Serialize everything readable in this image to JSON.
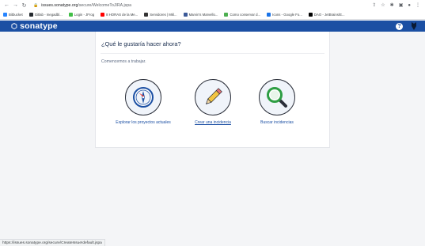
{
  "browser": {
    "url_host": "issues.sonatype.org",
    "url_path": "/secure/WelcomeToJIRA.jspa",
    "bookmarks": [
      {
        "label": "Bitbucket",
        "color": "#2684ff"
      },
      {
        "label": "Gitlab - megadbl...",
        "color": "#24292e"
      },
      {
        "label": "Login - JFrog",
        "color": "#41bf47"
      },
      {
        "label": "8 HORAS de la Me...",
        "color": "#ff0000"
      },
      {
        "label": "Servidores | Mkl...",
        "color": "#333333"
      },
      {
        "label": "Marvin's Marvello...",
        "color": "#3b5998"
      },
      {
        "label": "Como conservar d...",
        "color": "#4caf50"
      },
      {
        "label": "Icons - Google Fo...",
        "color": "#1a73e8"
      },
      {
        "label": "DAO - JetBrains/E...",
        "color": "#000000"
      }
    ],
    "status_url": "https://issues.sonatype.org/secure/CreateIssue!default.jspa"
  },
  "header": {
    "brand": "sonatype",
    "help_icon": "?"
  },
  "card": {
    "title": "¿Qué le gustaría hacer ahora?",
    "subtitle": "Comencemos a trabajar.",
    "options": [
      {
        "label": "Explorar los proyectos actuales",
        "icon": "compass-icon"
      },
      {
        "label": "Crear una incidencia",
        "icon": "pencil-icon"
      },
      {
        "label": "Buscar incidencias",
        "icon": "magnifier-icon"
      }
    ]
  },
  "colors": {
    "header_bg": "#1b4fa3",
    "link": "#1b4fa3",
    "page_bg": "#f4f5f7"
  }
}
